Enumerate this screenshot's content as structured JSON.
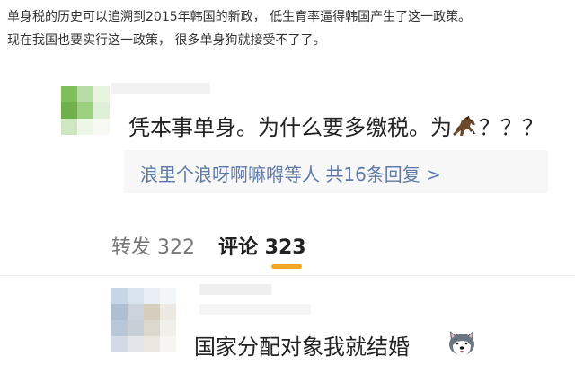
{
  "article": {
    "line1": "单身税的历史可以追溯到2015年韩国的新政， 低生育率逼得韩国产生了这一政策。",
    "line2": "现在我国也要实行这一政策， 很多单身狗就接受不了了。"
  },
  "comment1": {
    "text_before": "凭本事单身。为什么要多缴税。为",
    "emoji": "horse-icon",
    "text_after": "？？？",
    "replies_link": "浪里个浪呀啊嘛嘚等人 共16条回复 >"
  },
  "tabs": {
    "repost": "转发 322",
    "comment": "评论 323",
    "active_color": "#f5a623"
  },
  "comment2": {
    "text": "国家分配对象我就结婚",
    "emoji": "husky-icon"
  },
  "colors": {
    "link": "#5f7aa6",
    "reply_bg": "#f7f7f7"
  }
}
